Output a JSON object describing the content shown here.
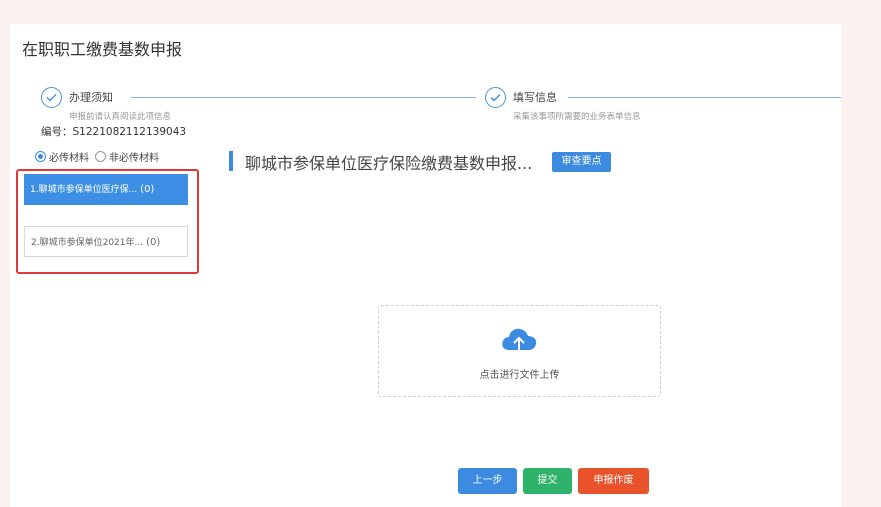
{
  "page": {
    "title": "在职职工缴费基数申报"
  },
  "steps": [
    {
      "title": "办理须知",
      "desc": "申报前请认真阅读此项信息"
    },
    {
      "title": "填写信息",
      "desc": "采集该事项所需要的业务表单信息"
    }
  ],
  "serial": "编号：S1221082112139043",
  "material_filter": {
    "options": [
      {
        "label": "必传材料",
        "selected": true
      },
      {
        "label": "非必传材料",
        "selected": false
      }
    ]
  },
  "materials": [
    {
      "label": "1.聊城市参保单位医疗保...",
      "count": "(0)",
      "active": true
    },
    {
      "label": "2.聊城市参保单位2021年...",
      "count": "(0)",
      "active": false
    }
  ],
  "content": {
    "title": "聊城市参保单位医疗保险缴费基数申报...",
    "review_button": "审查要点"
  },
  "upload": {
    "text": "点击进行文件上传",
    "icon": "cloud-upload-icon"
  },
  "actions": {
    "prev": "上一步",
    "submit": "提交",
    "void": "申报作废"
  },
  "colors": {
    "primary": "#3c8be0",
    "success": "#2fb36a",
    "danger": "#e8532b",
    "highlight": "#e0373b"
  }
}
